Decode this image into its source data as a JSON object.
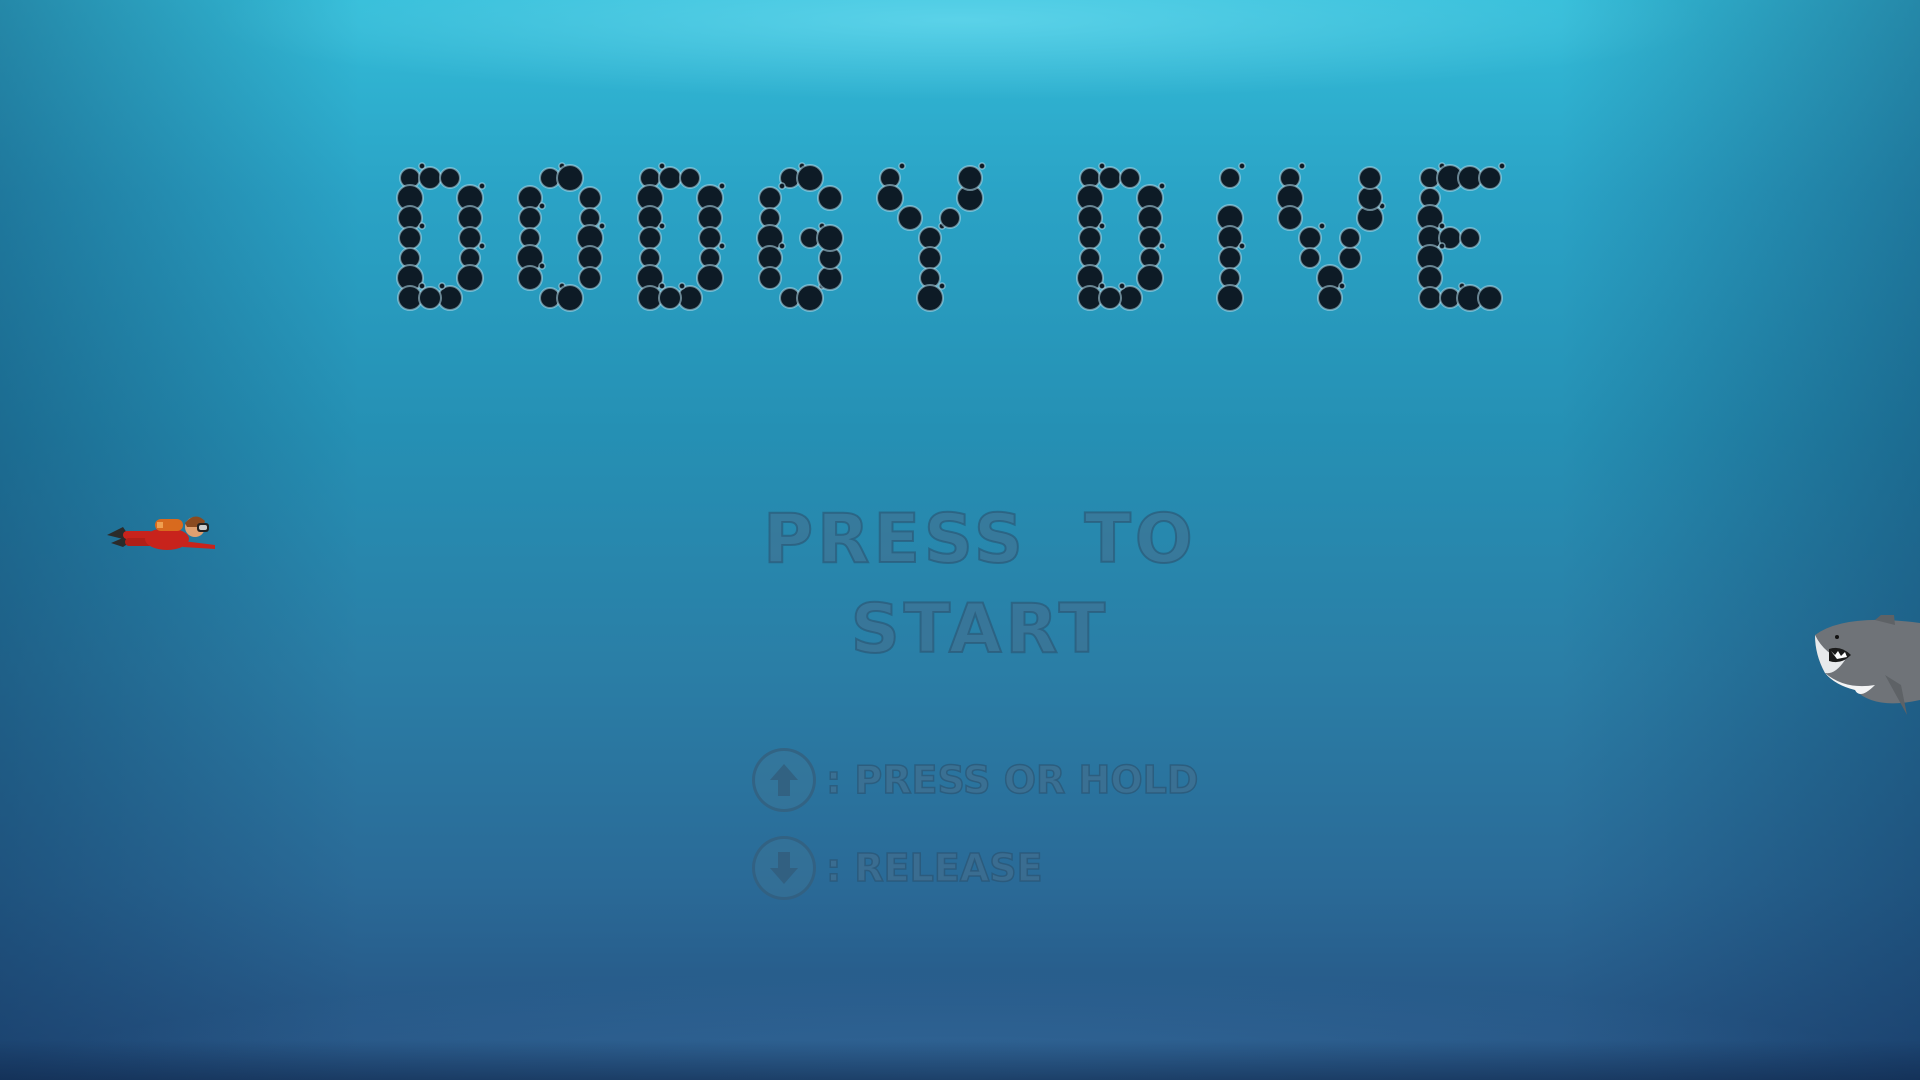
{
  "game": {
    "title": "DODGY DIVE",
    "start_prompt": "PRESS TO START",
    "controls": [
      {
        "icon": "arrow-up-icon",
        "label": ": PRESS OR HOLD"
      },
      {
        "icon": "arrow-down-icon",
        "label": ": RELEASE"
      }
    ]
  },
  "colors": {
    "water_top": "#33bcd8",
    "water_bottom": "#254f7f",
    "title_bubble": "#0d1b26",
    "diver_suit": "#c8231c",
    "shark": "#6f7378"
  }
}
